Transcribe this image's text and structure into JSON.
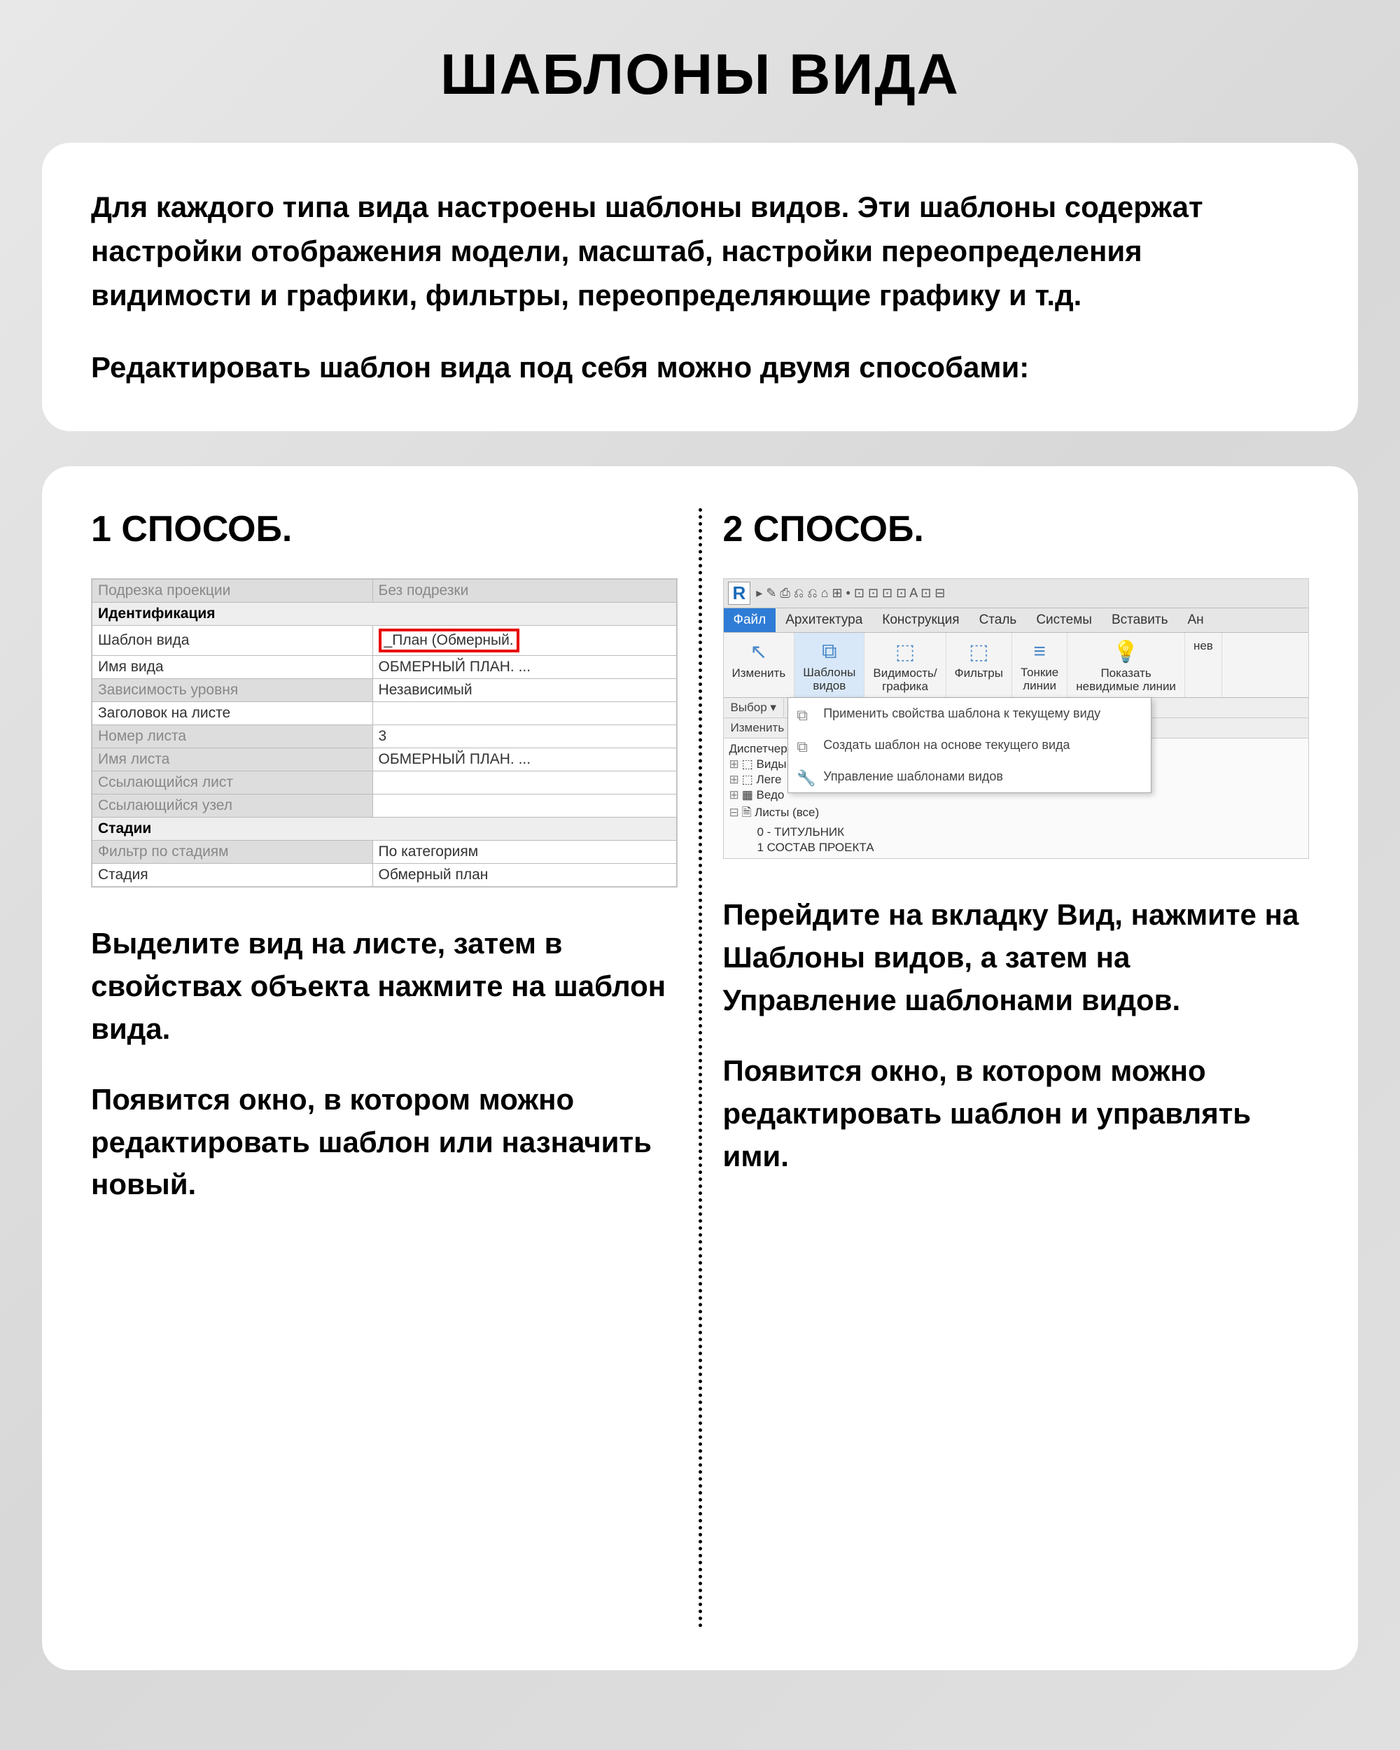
{
  "title": "ШАБЛОНЫ ВИДА",
  "intro": {
    "p1": "Для каждого типа вида настроены шаблоны видов. Эти шаблоны содержат настройки отображения модели, масштаб, настройки переопределения видимости и графики, фильтры, переопределяющие графику и т.д.",
    "p2": "Редактировать шаблон вида под себя можно двумя способами:"
  },
  "method1": {
    "heading": "1 СПОСОБ.",
    "props": {
      "r0_label": "Подрезка проекции",
      "r0_value": "Без подрезки",
      "section1": "Идентификация",
      "r1_label": "Шаблон вида",
      "r1_value": "_План (Обмерный.",
      "r2_label": "Имя вида",
      "r2_value": "ОБМЕРНЫЙ ПЛАН. ...",
      "r3_label": "Зависимость уровня",
      "r3_value": "Независимый",
      "r4_label": "Заголовок на листе",
      "r4_value": "",
      "r5_label": "Номер листа",
      "r5_value": "3",
      "r6_label": "Имя листа",
      "r6_value": "ОБМЕРНЫЙ ПЛАН. ...",
      "r7_label": "Ссылающийся лист",
      "r7_value": "",
      "r8_label": "Ссылающийся узел",
      "r8_value": "",
      "section2": "Стадии",
      "r9_label": "Фильтр по стадиям",
      "r9_value": "По категориям",
      "r10_label": "Стадия",
      "r10_value": "Обмерный план"
    },
    "desc1": "Выделите вид на листе, затем в свойствах объекта нажмите на шаблон вида.",
    "desc2": "Появится окно, в котором можно редактировать шаблон или назначить новый."
  },
  "method2": {
    "heading": "2 СПОСОБ.",
    "ribbon": {
      "logo": "R",
      "tabs": {
        "file": "Файл",
        "arch": "Архитектура",
        "constr": "Конструкция",
        "steel": "Сталь",
        "systems": "Системы",
        "insert": "Вставить",
        "an": "Ан"
      },
      "btns": {
        "modify": "Изменить",
        "templates": "Шаблоны\nвидов",
        "visibility": "Видимость/\nграфика",
        "filters": "Фильтры",
        "thinlines": "Тонкие\nлинии",
        "show": "Показать\nневидимые линии",
        "rem": "нев"
      },
      "menu": {
        "m1": "Применить свойства шаблона к текущему виду",
        "m2": "Создать шаблон на основе текущего вида",
        "m3": "Управление шаблонами видов"
      },
      "sub": {
        "select": "Выбор ▾",
        "modify": "Изменить |"
      },
      "browser": {
        "disp": "Диспетчер п",
        "views": "Виды",
        "leg": "Леге",
        "ved": "Ведо",
        "sheets": "Листы (все)",
        "s0": "0 - ТИТУЛЬНИК",
        "s1": "1   СОСТАВ ПРОЕКТА"
      }
    },
    "desc1": "Перейдите на вкладку Вид, нажмите на Шаблоны видов, а затем на Управление шаблонами видов.",
    "desc2": "Появится окно, в котором можно редактировать шаблон и управлять ими."
  }
}
